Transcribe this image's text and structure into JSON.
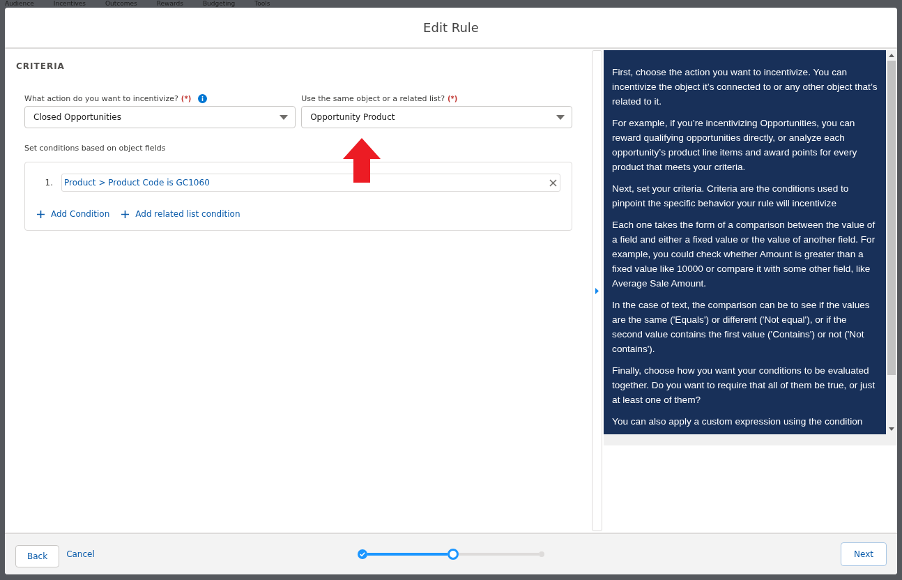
{
  "background_nav": {
    "items": [
      "Audience",
      "Incentives",
      "Outcomes",
      "Rewards",
      "Budgeting",
      "Tools"
    ]
  },
  "modal": {
    "title": "Edit Rule"
  },
  "criteria": {
    "heading": "CRITERIA",
    "fields": [
      {
        "label": "What action do you want to incentivize?",
        "required_mark": "(*)",
        "info": true,
        "value": "Closed Opportunities"
      },
      {
        "label": "Use the same object or a related list?",
        "required_mark": "(*)",
        "info": false,
        "value": "Opportunity Product"
      }
    ],
    "conditions_label": "Set conditions based on object fields",
    "conditions": [
      {
        "number": "1.",
        "text": "Product > Product Code is GC1060"
      }
    ],
    "actions": [
      "Add Condition",
      "Add related list condition"
    ]
  },
  "help_panel": {
    "paragraphs": [
      "First, choose the action you want to incentivize. You can incentivize the object it’s connected to or any other object that’s related to it.",
      "For example, if you’re incentivizing Opportunities, you can reward qualifying opportunities directly, or analyze each opportunity’s product line items and award points for every product that meets your criteria.",
      "Next, set your criteria. Criteria are the conditions used to pinpoint the specific behavior your rule will incentivize",
      "Each one takes the form of a comparison between the value of a field and either a fixed value or the value of another field. For example, you could check whether Amount is greater than a fixed value like 10000 or compare it with some other field, like Average Sale Amount.",
      "In the case of text, the comparison can be to see if the values are the same ('Equals') or different ('Not equal'), or if the second value contains the first value ('Contains') or not ('Not contains').",
      "Finally, choose how you want your conditions to be evaluated together. Do you want to require that all of them be true, or just at least one of them?",
      "You can also apply a custom expression using the condition"
    ]
  },
  "footer": {
    "back": "Back",
    "cancel": "Cancel",
    "next": "Next",
    "steps": [
      {
        "kind": "complete"
      },
      {
        "kind": "current"
      },
      {
        "kind": "upcoming"
      }
    ]
  }
}
